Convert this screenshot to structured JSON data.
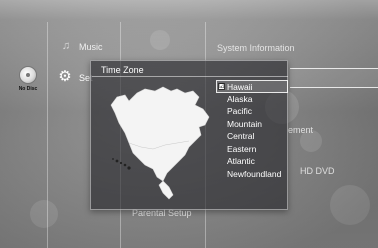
{
  "disc": {
    "label": "No Disc"
  },
  "menu": {
    "items": [
      {
        "label": "Music",
        "icon": "music-note-icon"
      },
      {
        "label": "Settings",
        "visible_text": "Set",
        "icon": "gear-icon"
      }
    ]
  },
  "right_column": {
    "items": [
      {
        "label": "System Information"
      },
      {
        "label": "ement"
      },
      {
        "label": "HD DVD"
      }
    ]
  },
  "bottom_item": {
    "label": "Parental Setup"
  },
  "dialog": {
    "title": "Time Zone",
    "timezones": [
      "Hawaii",
      "Alaska",
      "Pacific",
      "Mountain",
      "Central",
      "Eastern",
      "Atlantic",
      "Newfoundland"
    ],
    "selected": "Hawaii",
    "selected_checked": true,
    "checkmark": "☑"
  }
}
